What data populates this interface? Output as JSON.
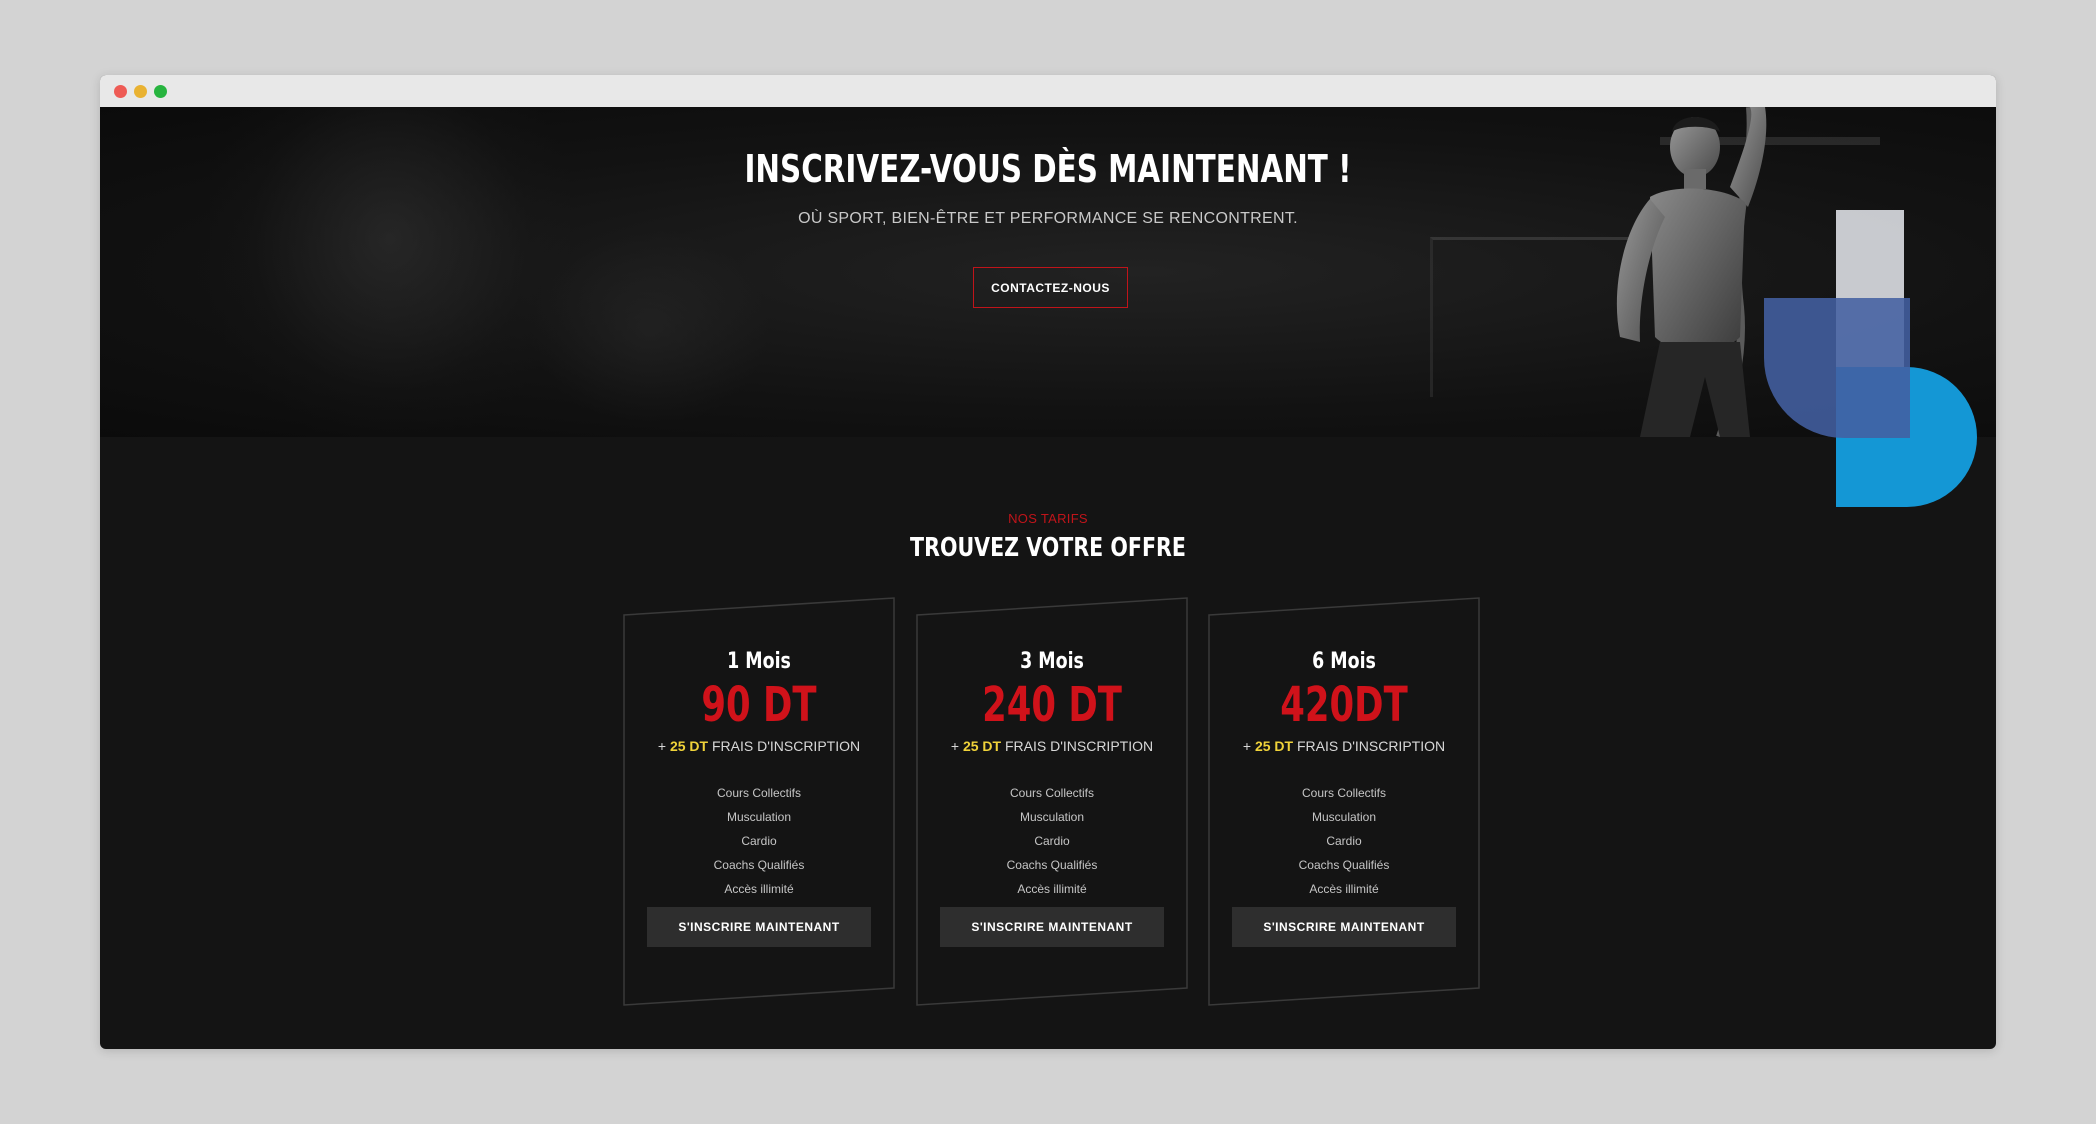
{
  "hero": {
    "title": "INSCRIVEZ-VOUS DÈS MAINTENANT !",
    "subtitle": "OÙ SPORT, BIEN-ÊTRE ET PERFORMANCE SE RENCONTRENT.",
    "cta_label": "CONTACTEZ-NOUS"
  },
  "pricing": {
    "label": "NOS TARIFS",
    "title": "TROUVEZ VOTRE OFFRE",
    "cards": [
      {
        "period": "1 Mois",
        "price": "90 DT",
        "fee_prefix": "+ ",
        "fee_amount": "25 DT",
        "fee_suffix": " FRAIS D'INSCRIPTION",
        "features": [
          "Cours Collectifs",
          "Musculation",
          "Cardio",
          "Coachs Qualifiés",
          "Accès illimité"
        ],
        "button_label": "S'INSCRIRE MAINTENANT"
      },
      {
        "period": "3 Mois",
        "price": "240 DT",
        "fee_prefix": "+ ",
        "fee_amount": "25 DT",
        "fee_suffix": " FRAIS D'INSCRIPTION",
        "features": [
          "Cours Collectifs",
          "Musculation",
          "Cardio",
          "Coachs Qualifiés",
          "Accès illimité"
        ],
        "button_label": "S'INSCRIRE MAINTENANT"
      },
      {
        "period": "6 Mois",
        "price": "420DT",
        "fee_prefix": "+ ",
        "fee_amount": "25 DT",
        "fee_suffix": " FRAIS D'INSCRIPTION",
        "features": [
          "Cours Collectifs",
          "Musculation",
          "Cardio",
          "Coachs Qualifiés",
          "Accès illimité"
        ],
        "button_label": "S'INSCRIRE MAINTENANT"
      }
    ]
  },
  "colors": {
    "accent_red": "#c0141a",
    "price_red": "#d0121a",
    "fee_yellow": "#f0d33a",
    "background": "#141414",
    "shape_blue": "#4360a2",
    "shape_cyan": "#1497d5"
  },
  "icons": {
    "window_controls": [
      "close-dot-icon",
      "minimize-dot-icon",
      "maximize-dot-icon"
    ]
  }
}
